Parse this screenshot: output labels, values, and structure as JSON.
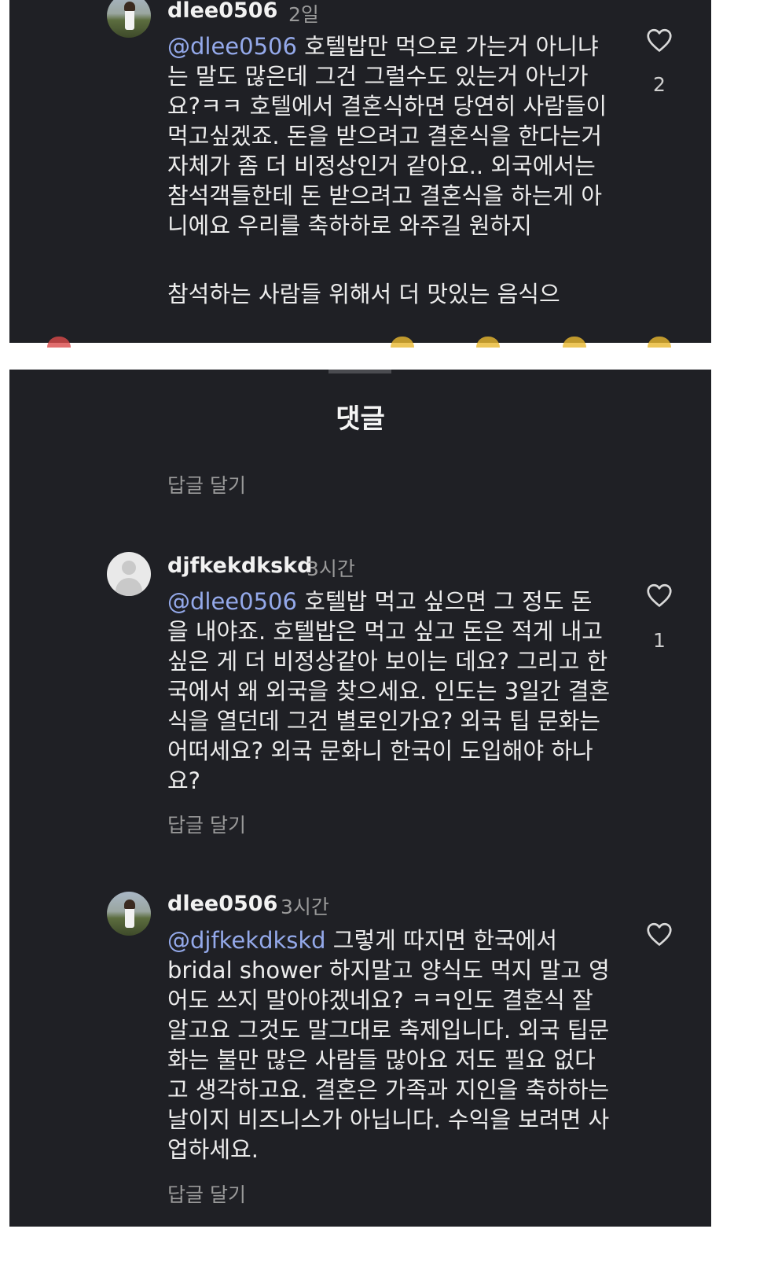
{
  "panel1": {
    "comment": {
      "username": "dlee0506",
      "time": "2일",
      "mention": "@dlee0506",
      "text": " 호텔밥만 먹으로 가는거 아니냐는 말도 많은데 그건 그럴수도 있는거 아닌가요?ㅋㅋ 호텔에서 결혼식하면 당연히 사람들이 먹고싶겠죠. 돈을 받으려고 결혼식을 한다는거 자체가 좀 더 비정상인거 같아요.. 외국에서는 참석객들한테 돈 받으려고 결혼식을 하는게 아니에요 우리를 축하하로 와주길 원하지",
      "text2": "참석하는 사람들 위해서 더 맛있는 음식으",
      "likes": "2"
    }
  },
  "panel2": {
    "title": "댓글",
    "reply_label_top": "답글 달기",
    "comments": [
      {
        "username": "djfkekdkskd",
        "time": "3시간",
        "mention": "@dlee0506",
        "text": " 호텔밥 먹고 싶으면 그 정도 돈을 내야죠. 호텔밥은 먹고 싶고 돈은 적게 내고 싶은 게 더 비정상같아 보이는 데요? 그리고 한국에서 왜 외국을 찾으세요. 인도는 3일간 결혼식을 열던데 그건 별로인가요? 외국 팁 문화는 어떠세요? 외국 문화니 한국이 도입해야 하나요?",
        "likes": "1",
        "reply": "답글 달기"
      },
      {
        "username": "dlee0506",
        "time": "3시간",
        "mention": "@djfkekdkskd",
        "text": " 그렇게 따지면 한국에서 bridal shower 하지말고 양식도 먹지 말고 영어도 쓰지 말아야겠네요? ㅋㅋ인도 결혼식 잘 알고요 그것도 말그대로 축제입니다. 외국 팁문화는 불만 많은 사람들 많아요 저도 필요 없다고 생각하고요. 결혼은 가족과 지인을 축하하는 날이지 비즈니스가 아닙니다. 수익을 보려면 사업하세요.",
        "likes": "",
        "reply": "답글 달기"
      }
    ]
  },
  "icons": {
    "heart": "heart-outline-icon",
    "avatar_photo": "avatar-photo",
    "avatar_default": "avatar-default-icon"
  }
}
